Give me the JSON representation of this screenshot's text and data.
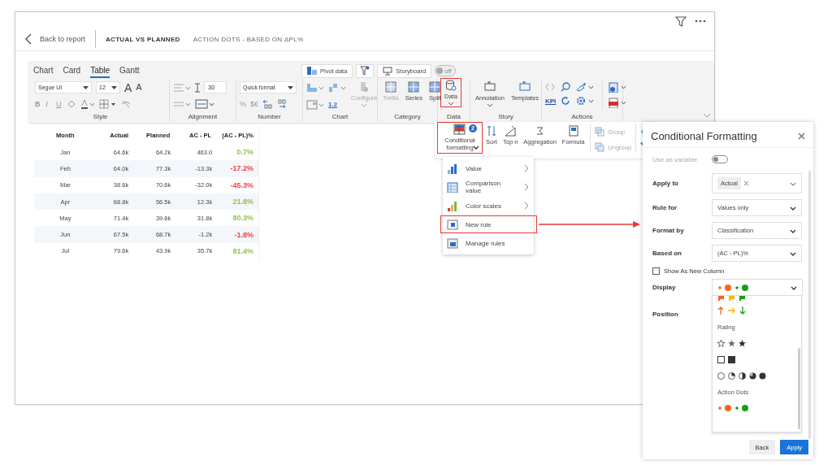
{
  "header": {
    "back": "Back to report",
    "title": "ACTUAL VS PLANNED",
    "subtitle": "ACTION DOTS - BASED ON ΔPL%"
  },
  "ribbon": {
    "tabs": [
      {
        "label": "Chart",
        "selected": false
      },
      {
        "label": "Card",
        "selected": false
      },
      {
        "label": "Table",
        "selected": true
      },
      {
        "label": "Gantt",
        "selected": false
      }
    ],
    "pivot": "Pivot data",
    "storyboard": "Storyboard",
    "toggle": {
      "label": "off",
      "on": false
    },
    "font": "Segoe UI",
    "size": "12",
    "grow": "A",
    "shrink": "A",
    "bold": "B",
    "italic": "I",
    "underline": "U",
    "spacing": "30",
    "quick_format": "Quick format",
    "percent": "%",
    "currency": "$€",
    "decimal_format": "1.2",
    "configure": "Configure",
    "category": [
      "Trellis",
      "Series",
      "Split"
    ],
    "data": {
      "label": "Data",
      "highlighted": true
    },
    "story": [
      "Annotation",
      "Templates"
    ],
    "kpi": "KPI",
    "groups": [
      "Style",
      "Alignment",
      "Number",
      "Chart",
      "Category",
      "Data",
      "Story",
      "Actions"
    ]
  },
  "data_menu": {
    "conditional": {
      "label": "Conditional formatting",
      "badge": "2",
      "highlighted": true
    },
    "tools": [
      "Sort",
      "Top n",
      "Aggregation",
      "Formula"
    ],
    "group": "Group",
    "ungroup": "Ungroup",
    "items": [
      {
        "label": "Value",
        "kind": "value",
        "submenu": true,
        "highlighted": false
      },
      {
        "label": "Comparison value",
        "kind": "comparison",
        "submenu": true,
        "highlighted": false
      },
      {
        "label": "Color scales",
        "kind": "scales",
        "submenu": true,
        "highlighted": false
      },
      {
        "label": "New rule",
        "kind": "new",
        "submenu": false,
        "highlighted": true
      },
      {
        "label": "Manage rules",
        "kind": "manage",
        "submenu": false,
        "highlighted": false
      }
    ]
  },
  "table": {
    "columns": [
      "Month",
      "Actual",
      "Planned",
      "AC - PL",
      "(AC - PL)%"
    ],
    "rows": [
      {
        "cells": [
          "Jan",
          "64.6k",
          "64.2k",
          "463.0",
          "0.7%"
        ],
        "color": "#8dc63f"
      },
      {
        "cells": [
          "Feb",
          "64.0k",
          "77.3k",
          "-13.3k",
          "-17.2%"
        ],
        "color": "#ff3b3b"
      },
      {
        "cells": [
          "Mar",
          "38.6k",
          "70.6k",
          "-32.0k",
          "-45.3%"
        ],
        "color": "#ff3b3b"
      },
      {
        "cells": [
          "Apr",
          "68.8k",
          "56.5k",
          "12.3k",
          "21.8%"
        ],
        "color": "#8dc63f"
      },
      {
        "cells": [
          "May",
          "71.4k",
          "39.6k",
          "31.8k",
          "80.3%"
        ],
        "color": "#8dc63f"
      },
      {
        "cells": [
          "Jun",
          "67.5k",
          "68.7k",
          "-1.2k",
          "-1.8%"
        ],
        "color": "#ff3b3b"
      },
      {
        "cells": [
          "Jul",
          "79.6k",
          "43.9k",
          "35.7k",
          "81.4%"
        ],
        "color": "#8dc63f"
      }
    ]
  },
  "panel": {
    "title": "Conditional Formatting",
    "variable": {
      "label": "Use as variable",
      "on": false
    },
    "apply_to": {
      "label": "Apply to",
      "chip": "Actual"
    },
    "fields": [
      {
        "label": "Rule for",
        "value": "Values only"
      },
      {
        "label": "Format by",
        "value": "Classification"
      },
      {
        "label": "Based on",
        "value": "(AC - PL)%"
      }
    ],
    "new_column": {
      "label": "Show As New Column",
      "checked": false
    },
    "display": {
      "label": "Display",
      "kind": "dots"
    },
    "position": "Position",
    "options": [
      {
        "kind": "flags"
      },
      {
        "kind": "arrows"
      },
      {
        "kind": "heading",
        "label": "Rating"
      },
      {
        "kind": "stars"
      },
      {
        "kind": "squares"
      },
      {
        "kind": "pies"
      },
      {
        "kind": "heading",
        "label": "Action Dots"
      },
      {
        "kind": "dots"
      }
    ],
    "buttons": [
      {
        "label": "Back",
        "primary": false
      },
      {
        "label": "Apply",
        "primary": true
      }
    ]
  }
}
